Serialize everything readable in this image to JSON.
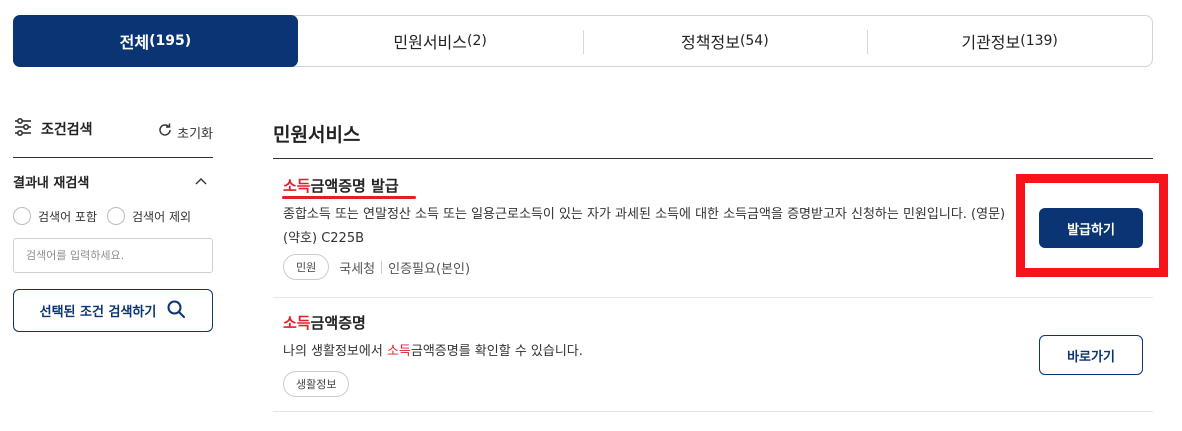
{
  "tabs": [
    {
      "label": "전체",
      "count": "(195)",
      "active": true
    },
    {
      "label": "민원서비스",
      "count": "(2)",
      "active": false
    },
    {
      "label": "정책정보",
      "count": "(54)",
      "active": false
    },
    {
      "label": "기관정보",
      "count": "(139)",
      "active": false
    }
  ],
  "sidebar": {
    "filter_title": "조건검색",
    "reset_label": "초기화",
    "research_label": "결과내 재검색",
    "radio_include": "검색어 포함",
    "radio_exclude": "검색어 제외",
    "search_placeholder": "검색어를 입력하세요.",
    "search_button": "선택된 조건 검색하기"
  },
  "main": {
    "section_title": "민원서비스",
    "items": [
      {
        "title_hl": "소득",
        "title_rest": "금액증명 발급",
        "desc": "종합소득 또는 연말정산 소득 또는 일용근로소득이 있는 자가 과세된 소득에 대한 소득금액을 증명받고자 신청하는 민원입니다. (영문)(약호) C225B",
        "badge": "민원",
        "agency": "국세청",
        "auth": "인증필요(본인)",
        "button": "발급하기"
      },
      {
        "title_hl": "소득",
        "title_rest": "금액증명",
        "desc_pre": "나의 생활정보에서 ",
        "desc_hl": "소득",
        "desc_post": "금액증명를 확인할 수 있습니다.",
        "badge": "생활정보",
        "button": "바로가기"
      }
    ]
  },
  "colors": {
    "primary": "#0b3474",
    "highlight": "#e0202a",
    "annotation_box": "#f5141a"
  },
  "icons": [
    "filter-sliders-icon",
    "refresh-icon",
    "chevron-up-icon",
    "search-icon"
  ]
}
